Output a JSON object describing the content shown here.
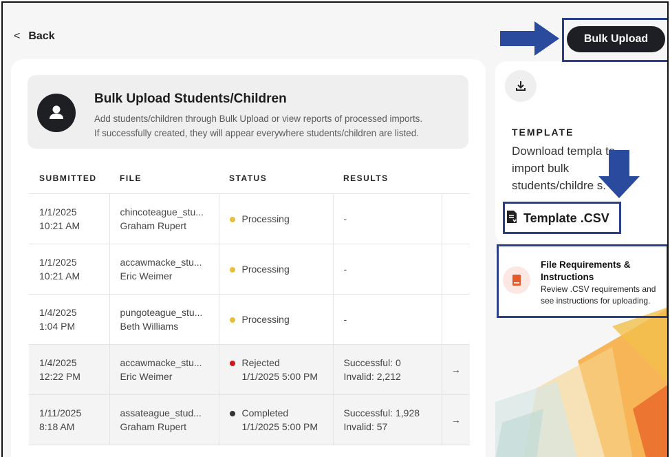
{
  "nav": {
    "back_label": "Back"
  },
  "header": {
    "bulk_upload_label": "Bulk Upload"
  },
  "hero": {
    "title": "Bulk Upload Students/Children",
    "line1": "Add students/children through Bulk Upload or view reports of processed imports.",
    "line2": "If successfully created, they will appear everywhere students/children are listed."
  },
  "table": {
    "headers": [
      "SUBMITTED",
      "FILE",
      "STATUS",
      "RESULTS"
    ],
    "rows": [
      {
        "date": "1/1/2025",
        "time": "10:21 AM",
        "file": "chincoteague_stu...",
        "user": "Graham Rupert",
        "status": "Processing",
        "status_date": "",
        "result1": "-",
        "result2": "",
        "has_arrow": false,
        "status_color": "#e8bf3a"
      },
      {
        "date": "1/1/2025",
        "time": "10:21 AM",
        "file": "accawmacke_stu...",
        "user": "Eric Weimer",
        "status": "Processing",
        "status_date": "",
        "result1": "-",
        "result2": "",
        "has_arrow": false,
        "status_color": "#e8bf3a"
      },
      {
        "date": "1/4/2025",
        "time": "1:04 PM",
        "file": "pungoteague_stu...",
        "user": "Beth Williams",
        "status": "Processing",
        "status_date": "",
        "result1": "-",
        "result2": "",
        "has_arrow": false,
        "status_color": "#e8bf3a"
      },
      {
        "date": "1/4/2025",
        "time": "12:22 PM",
        "file": "accawmacke_stu...",
        "user": "Eric Weimer",
        "status": "Rejected",
        "status_date": "1/1/2025 5:00 PM",
        "result1": "Successful: 0",
        "result2": "Invalid: 2,212",
        "has_arrow": true,
        "status_color": "#d0161b"
      },
      {
        "date": "1/11/2025",
        "time": "8:18 AM",
        "file": "assateague_stud...",
        "user": "Graham Rupert",
        "status": "Completed",
        "status_date": "1/1/2025 5:00 PM",
        "result1": "Successful: 1,928",
        "result2": "Invalid: 57",
        "has_arrow": true,
        "status_color": "#333333"
      }
    ],
    "row_arrow": "→"
  },
  "template": {
    "heading": "TEMPLATE",
    "description_visible": "Download templa  to import bulk students/childre  s.",
    "link_label": "Template .CSV"
  },
  "requirements": {
    "title": "File Requirements & Instructions",
    "description": "Review .CSV requirements and see instructions for uploading."
  },
  "colors": {
    "annotation_blue": "#2a4a9e",
    "dark_button": "#1d1f24",
    "processing": "#e8bf3a",
    "rejected": "#d0161b",
    "completed": "#333333"
  }
}
